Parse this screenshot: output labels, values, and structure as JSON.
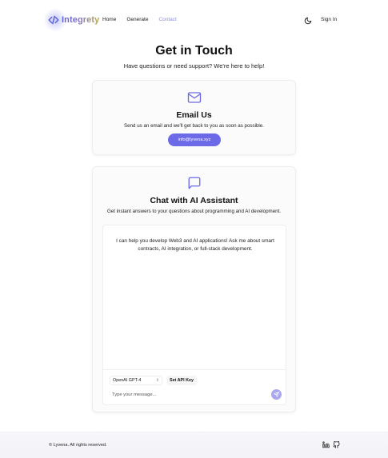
{
  "header": {
    "logo_text": "Integrety",
    "nav": [
      {
        "label": "Home"
      },
      {
        "label": "Generate"
      },
      {
        "label": "Contact"
      }
    ],
    "sign_in_label": "Sign In"
  },
  "hero": {
    "title": "Get in Touch",
    "subtitle": "Have questions or need support? We're here to help!"
  },
  "email_card": {
    "title": "Email Us",
    "description": "Send us an email and we'll get back to you as soon as possible.",
    "email_button": "info@lyvena.xyz"
  },
  "chat_card": {
    "title": "Chat with AI Assistant",
    "description": "Get instant answers to your questions about programming and AI development.",
    "assistant_message": "I can help you develop Web3 and AI applications! Ask me about smart contracts, AI integration, or full-stack development.",
    "model_selected": "OpenAI GPT-4",
    "api_key_button": "Set API Key",
    "input_placeholder": "Type your message..."
  },
  "footer": {
    "copyright": "© Lyvena. All rights reserved."
  },
  "colors": {
    "accent": "#6d6ae8",
    "accent_light": "#a9a7ee",
    "active_nav": "#8b8de6"
  }
}
